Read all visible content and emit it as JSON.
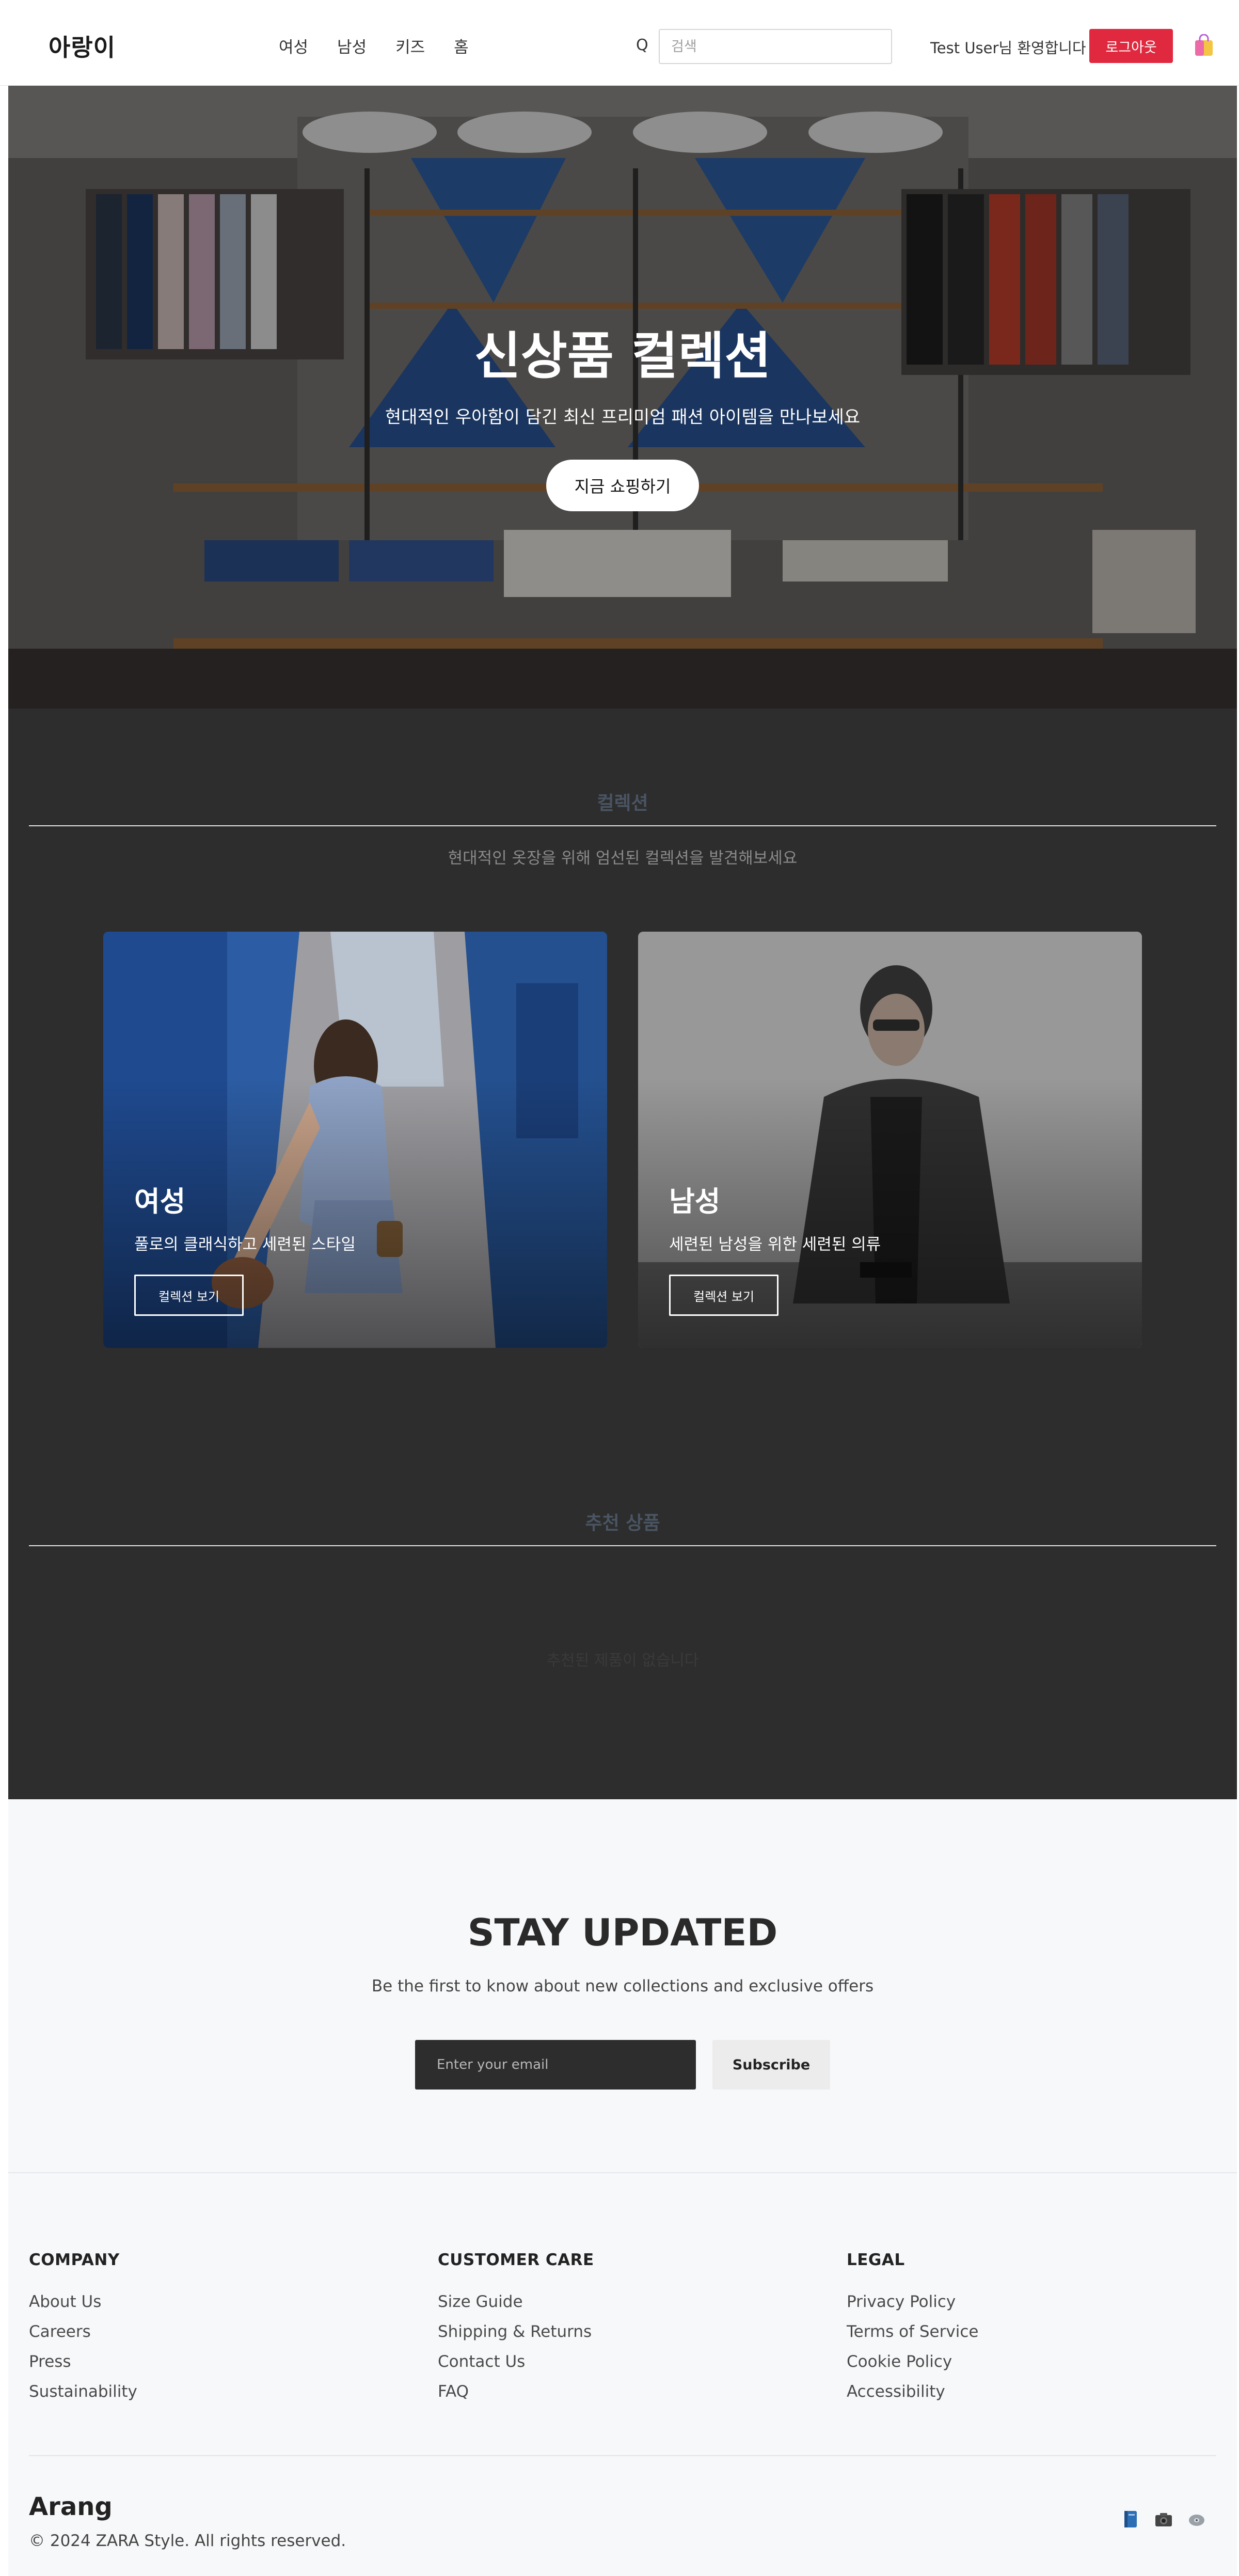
{
  "header": {
    "logo": "아랑이",
    "nav": [
      "여성",
      "남성",
      "키즈",
      "홈"
    ],
    "search_icon_glyph": "Q",
    "search_placeholder": "검색",
    "welcome": "Test User님 환영합니다",
    "logout_label": "로그아웃",
    "cart_icon": "shopping-bag-icon",
    "accent_color": "#e0283e"
  },
  "hero": {
    "title": "신상품 컬렉션",
    "subtitle": "현대적인 우아함이 담긴 최신 프리미엄 패션 아이템을 만나보세요",
    "cta_label": "지금 쇼핑하기"
  },
  "collections": {
    "title": "컬렉션",
    "description": "현대적인 옷장을 위해 엄선된 컬렉션을 발견해보세요",
    "cards": [
      {
        "title": "여성",
        "description": "풀로의 클래식하고 세련된 스타일",
        "button": "컬렉션 보기"
      },
      {
        "title": "남성",
        "description": "세련된 남성을 위한 세련된 의류",
        "button": "컬렉션 보기"
      }
    ]
  },
  "featured": {
    "title": "추천 상품",
    "empty_message": "추천된 제품이 없습니다"
  },
  "newsletter": {
    "title": "STAY UPDATED",
    "description": "Be the first to know about new collections and exclusive offers",
    "email_placeholder": "Enter your email",
    "subscribe_label": "Subscribe"
  },
  "footer": {
    "columns": [
      {
        "heading": "COMPANY",
        "links": [
          "About Us",
          "Careers",
          "Press",
          "Sustainability"
        ]
      },
      {
        "heading": "CUSTOMER CARE",
        "links": [
          "Size Guide",
          "Shipping & Returns",
          "Contact Us",
          "FAQ"
        ]
      },
      {
        "heading": "LEGAL",
        "links": [
          "Privacy Policy",
          "Terms of Service",
          "Cookie Policy",
          "Accessibility"
        ]
      }
    ],
    "brand": "Arang",
    "copyright": "© 2024 ZARA Style. All rights reserved.",
    "social_icons": [
      "book-icon",
      "camera-icon",
      "disc-icon"
    ]
  }
}
